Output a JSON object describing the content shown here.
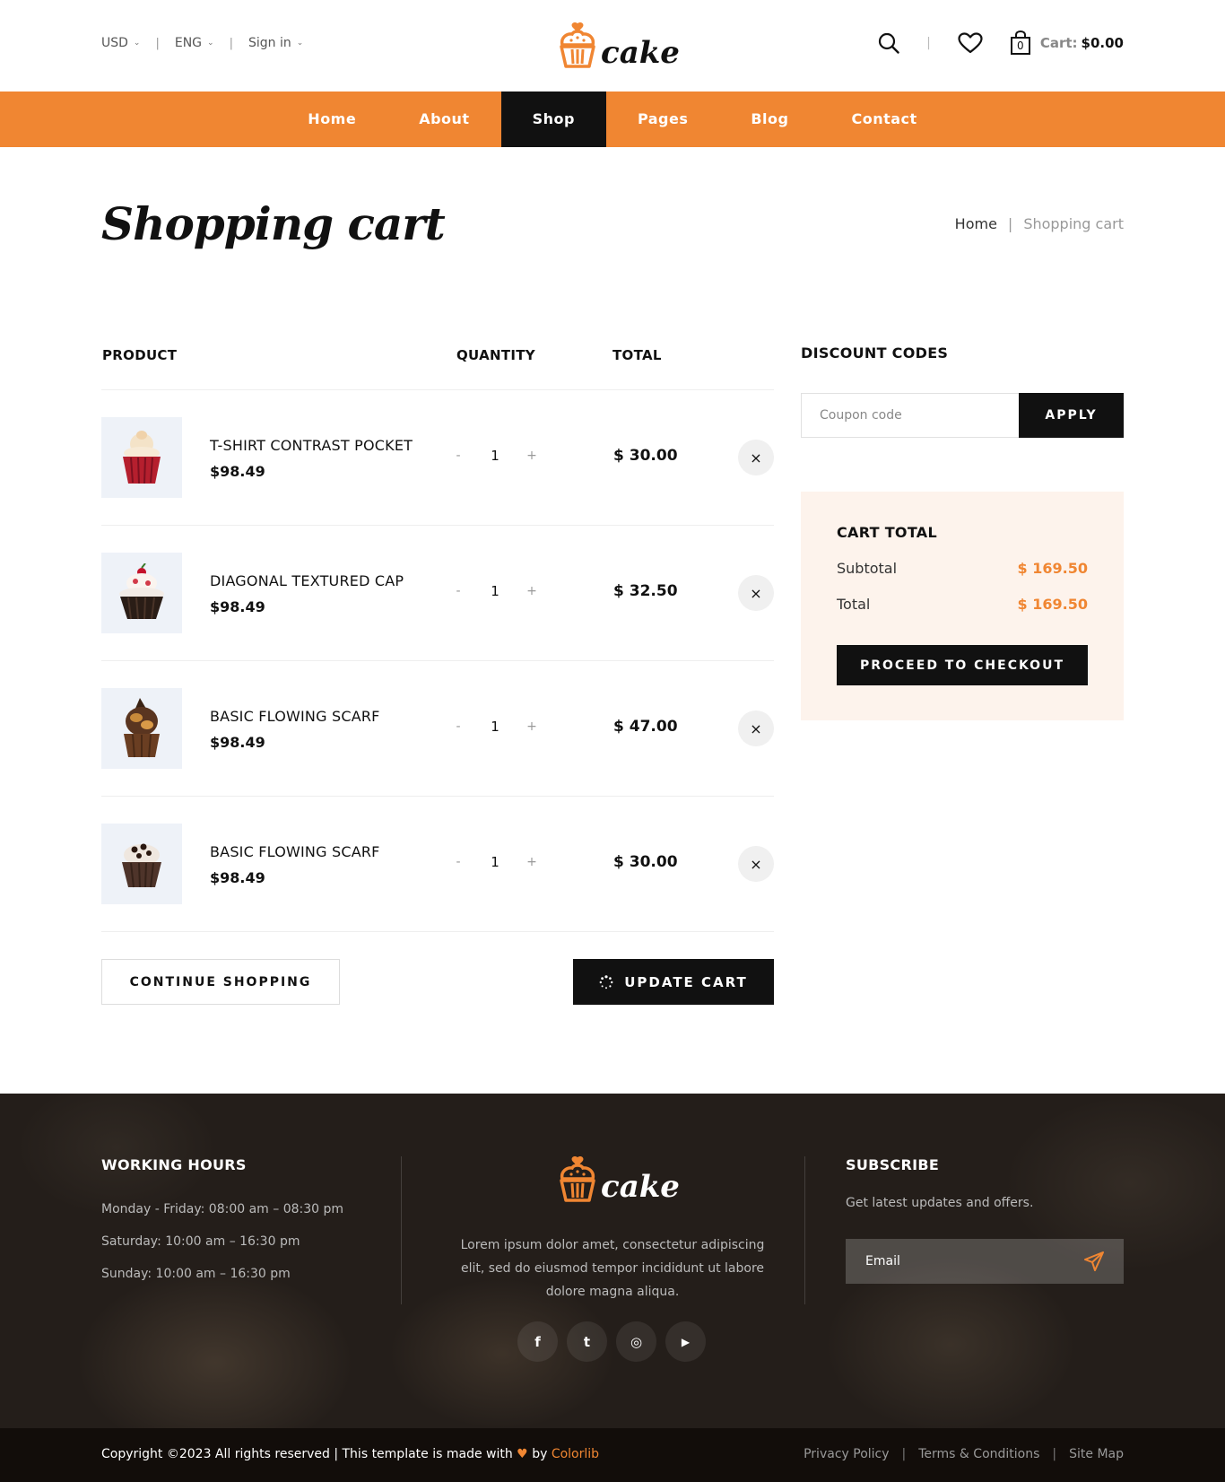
{
  "header": {
    "currency": "USD",
    "language": "ENG",
    "signin": "Sign in",
    "logo_text": "cake",
    "cart_label": "Cart:",
    "cart_amount": "$0.00",
    "cart_count": "0"
  },
  "nav": [
    {
      "label": "Home"
    },
    {
      "label": "About"
    },
    {
      "label": "Shop",
      "active": true
    },
    {
      "label": "Pages"
    },
    {
      "label": "Blog"
    },
    {
      "label": "Contact"
    }
  ],
  "page": {
    "title": "Shopping cart",
    "breadcrumb": [
      "Home",
      "Shopping cart"
    ]
  },
  "cart": {
    "columns": [
      "PRODUCT",
      "QUANTITY",
      "TOTAL"
    ],
    "items": [
      {
        "name": "T-SHIRT CONTRAST POCKET",
        "price": "$98.49",
        "qty": "1",
        "total": "$ 30.00",
        "minus": "-",
        "plus": "+",
        "remove": "×"
      },
      {
        "name": "DIAGONAL TEXTURED CAP",
        "price": "$98.49",
        "qty": "1",
        "total": "$ 32.50",
        "minus": "-",
        "plus": "+",
        "remove": "×"
      },
      {
        "name": "BASIC FLOWING SCARF",
        "price": "$98.49",
        "qty": "1",
        "total": "$ 47.00",
        "minus": "-",
        "plus": "+",
        "remove": "×"
      },
      {
        "name": "BASIC FLOWING SCARF",
        "price": "$98.49",
        "qty": "1",
        "total": "$ 30.00",
        "minus": "-",
        "plus": "+",
        "remove": "×"
      }
    ],
    "continue_label": "CONTINUE SHOPPING",
    "update_label": "UPDATE CART"
  },
  "discount": {
    "title": "DISCOUNT CODES",
    "placeholder": "Coupon code",
    "apply_label": "APPLY"
  },
  "cart_total": {
    "title": "CART TOTAL",
    "subtotal_label": "Subtotal",
    "subtotal_value": "$ 169.50",
    "total_label": "Total",
    "total_value": "$ 169.50",
    "checkout_label": "PROCEED TO CHECKOUT"
  },
  "footer": {
    "hours_title": "WORKING HOURS",
    "hours": [
      "Monday - Friday: 08:00 am – 08:30 pm",
      "Saturday: 10:00 am – 16:30 pm",
      "Sunday: 10:00 am – 16:30 pm"
    ],
    "logo_text": "cake",
    "about_text": "Lorem ipsum dolor amet, consectetur adipiscing elit, sed do eiusmod tempor incididunt ut labore dolore magna aliqua.",
    "social": [
      {
        "icon": "facebook-icon",
        "glyph": "f"
      },
      {
        "icon": "twitter-icon",
        "glyph": "t"
      },
      {
        "icon": "instagram-icon",
        "glyph": "◎"
      },
      {
        "icon": "youtube-icon",
        "glyph": "▶"
      }
    ],
    "subscribe_title": "SUBSCRIBE",
    "subscribe_text": "Get latest updates and offers.",
    "email_placeholder": "Email",
    "copyright_prefix": "Copyright ©2023 All rights reserved | This template is made with",
    "copyright_by": "by",
    "copyright_brand": "Colorlib",
    "links": [
      "Privacy Policy",
      "Terms & Conditions",
      "Site Map"
    ]
  },
  "colors": {
    "accent": "#f08632",
    "dark": "#111111",
    "cart_total_bg": "#fdf3ec",
    "footer_bg": "#241e1a"
  }
}
